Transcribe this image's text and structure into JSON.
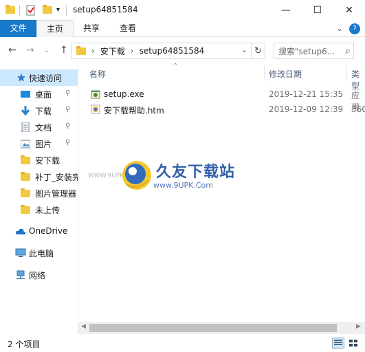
{
  "window": {
    "title": "setup64851584",
    "qa_dropdown": "▾",
    "minimize": "—",
    "maximize": "☐",
    "close": "✕"
  },
  "ribbon": {
    "tabs": [
      "文件",
      "主页",
      "共享",
      "查看"
    ],
    "collapse": "⌄",
    "help": "?"
  },
  "address": {
    "back": "←",
    "forward": "→",
    "recent": "⌄",
    "up": "↑",
    "crumbs": [
      "安下载",
      "setup64851584"
    ],
    "crumb_sep": "›",
    "dropdown": "⌄",
    "refresh": "↻",
    "search_placeholder": "搜索\"setup6...",
    "search_icon": "⌕"
  },
  "nav": {
    "items": [
      {
        "label": "快速访问",
        "icon": "star-icon"
      },
      {
        "label": "桌面",
        "icon": "desktop-icon",
        "pinned": true
      },
      {
        "label": "下载",
        "icon": "download-icon",
        "pinned": true
      },
      {
        "label": "文档",
        "icon": "document-icon",
        "pinned": true
      },
      {
        "label": "图片",
        "icon": "picture-icon",
        "pinned": true
      },
      {
        "label": "安下载",
        "icon": "folder-icon"
      },
      {
        "label": "补丁_安装完",
        "icon": "folder-icon"
      },
      {
        "label": "图片管理器",
        "icon": "folder-icon"
      },
      {
        "label": "未上传",
        "icon": "folder-icon"
      },
      {
        "label": "OneDrive",
        "icon": "cloud-icon"
      },
      {
        "label": "此电脑",
        "icon": "computer-icon"
      },
      {
        "label": "网络",
        "icon": "network-icon"
      }
    ],
    "pin_glyph": "📌"
  },
  "columns": {
    "name": "名称",
    "date": "修改日期",
    "type": "类型"
  },
  "files": [
    {
      "name": "setup.exe",
      "date": "2019-12-21 15:35",
      "type": "应用",
      "icon": "exe-icon"
    },
    {
      "name": "安下载帮助.htm",
      "date": "2019-12-09 12:39",
      "type": "360",
      "icon": "htm-icon"
    }
  ],
  "watermark": {
    "brand": "久友下载站",
    "url": "www.9UPK.Com",
    "side": "WWW.9UPK.COM"
  },
  "status": {
    "count": "2 个项目"
  },
  "colors": {
    "accent": "#1979ca",
    "selected": "#cce8ff",
    "folder": "#f0c93f"
  }
}
